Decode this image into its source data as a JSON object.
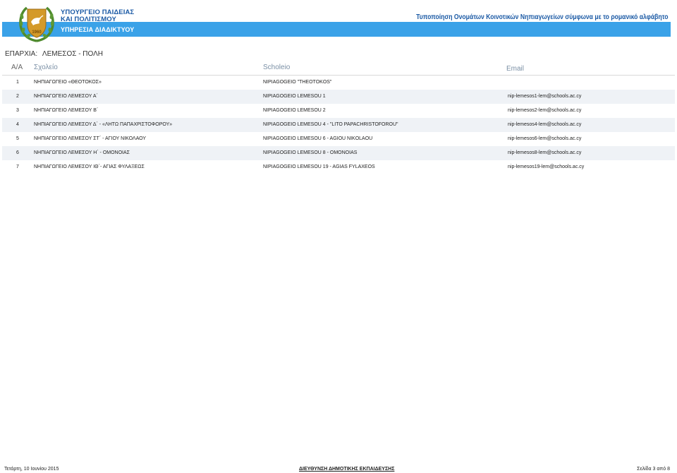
{
  "header": {
    "ministry_line1": "ΥΠΟΥΡΓΕΙΟ ΠΑΙΔΕΙΑΣ",
    "ministry_line2": "ΚΑΙ ΠΟΛΙΤΙΣΜΟΥ",
    "ministry_line3": "ΥΠΗΡΕΣΙΑ ΔΙΑΔΙΚΤΥΟΥ",
    "doc_title": "Τυποποίηση Ονομάτων Κοινοτικών Νηπιαγωγείων σύμφωνα με το ρομανικό αλφάβητο",
    "bar_color": "#3aa2e8",
    "title_color": "#1b5aa5",
    "logo_icon": "cyprus-coat-of-arms-icon"
  },
  "eparchia": {
    "label": "ΕΠΑΡΧΙΑ:",
    "value": "ΛΕΜΕΣΟΣ - ΠΟΛΗ"
  },
  "table": {
    "headers": {
      "aa": "Α/Α",
      "school": "Σχολείο",
      "scholeio": "Scholeio",
      "email": "Email"
    },
    "rows": [
      {
        "aa": "1",
        "school": "ΝΗΠΙΑΓΩΓΕΙΟ «ΘΕΟΤΟΚΟΣ»",
        "scholeio": "NIPIAGOGEIO \"THEOTOKOS\"",
        "email": ""
      },
      {
        "aa": "2",
        "school": "ΝΗΠΙΑΓΩΓΕΙΟ ΛΕΜΕΣΟΥ Α΄",
        "scholeio": "NIPIAGOGEIO LEMESOU 1",
        "email": "nip-lemesos1-lem@schools.ac.cy"
      },
      {
        "aa": "3",
        "school": "ΝΗΠΙΑΓΩΓΕΙΟ ΛΕΜΕΣΟΥ Β΄",
        "scholeio": "NIPIAGOGEIO LEMESOU 2",
        "email": "nip-lemesos2-lem@schools.ac.cy"
      },
      {
        "aa": "4",
        "school": "ΝΗΠΙΑΓΩΓΕΙΟ ΛΕΜΕΣΟΥ Δ΄ - «ΛΗΤΩ ΠΑΠΑΧΡΙΣΤΟΦΟΡΟΥ»",
        "scholeio": "NIPIAGOGEIO LEMESOU 4 - \"LITO PAPACHRISTOFOROU\"",
        "email": "nip-lemesos4-lem@schools.ac.cy"
      },
      {
        "aa": "5",
        "school": "ΝΗΠΙΑΓΩΓΕΙΟ ΛΕΜΕΣΟΥ ΣΤ΄ - ΑΓΙΟΥ ΝΙΚΟΛΑΟΥ",
        "scholeio": "NIPIAGOGEIO LEMESOU 6 - AGIOU NIKOLAOU",
        "email": "nip-lemesos6-lem@schools.ac.cy"
      },
      {
        "aa": "6",
        "school": "ΝΗΠΙΑΓΩΓΕΙΟ ΛΕΜΕΣΟΥ Η΄ - ΟΜΟΝΟΙΑΣ",
        "scholeio": "NIPIAGOGEIO LEMESOU 8 - OMONOIAS",
        "email": "nip-lemesos8-lem@schools.ac.cy"
      },
      {
        "aa": "7",
        "school": "ΝΗΠΙΑΓΩΓΕΙΟ ΛΕΜΕΣΟΥ ΙΘ΄- ΑΓΙΑΣ ΦΥΛΑΞΕΩΣ",
        "scholeio": "NIPIAGOGEIO LEMESOU 19 - AGIAS FYLAXEOS",
        "email": "nip-lemesos19-lem@schools.ac.cy"
      }
    ]
  },
  "footer": {
    "date": "Τετάρτη, 10 Ιουνίου 2015",
    "department": "ΔΙΕΥΘΥΝΣΗ ΔΗΜΟΤΙΚΗΣ ΕΚΠΑΙΔΕΥΣΗΣ",
    "page": "Σελίδα 3 από 8"
  }
}
